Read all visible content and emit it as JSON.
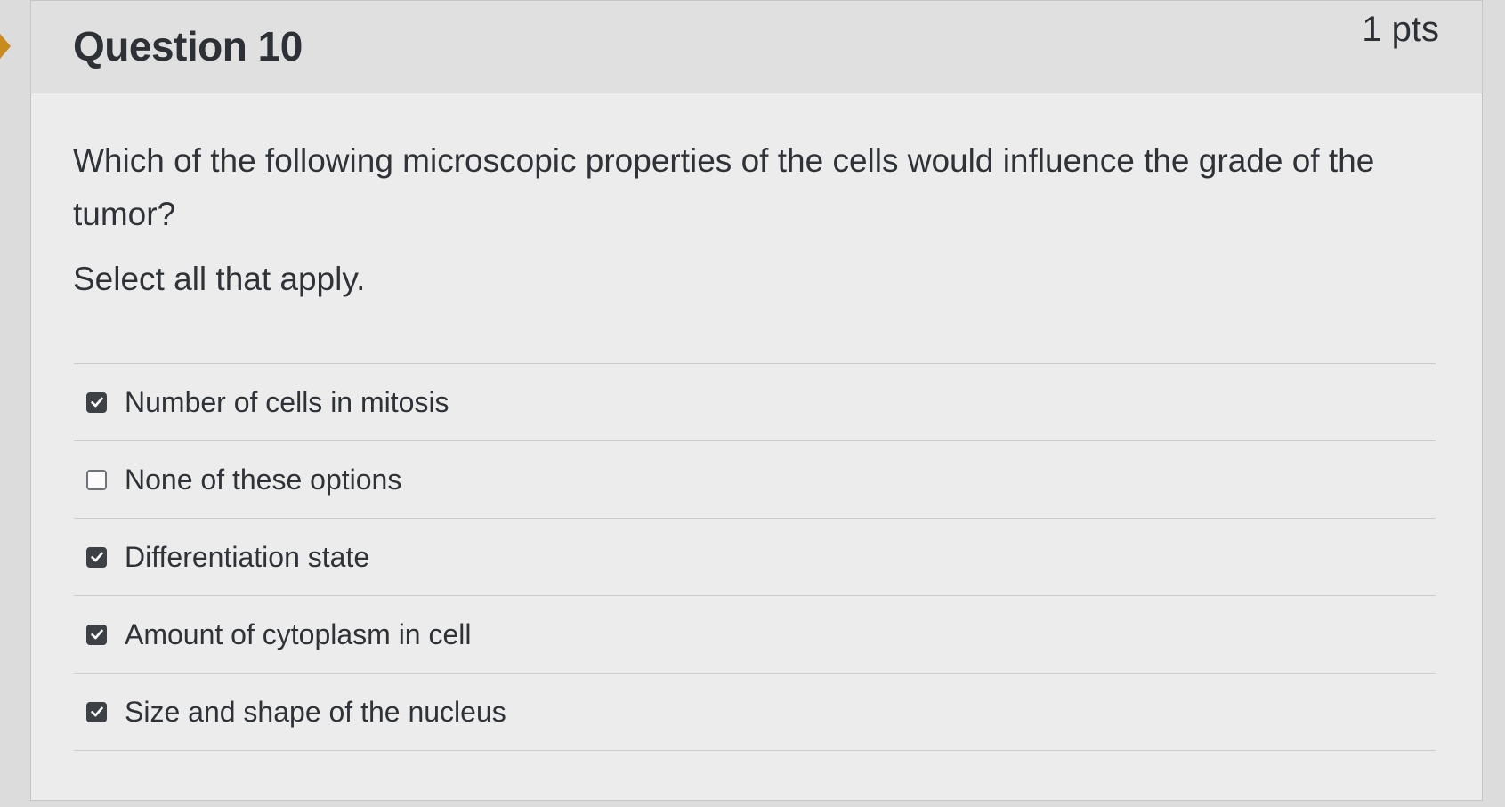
{
  "question": {
    "title": "Question 10",
    "points": "1 pts",
    "text": "Which of the following microscopic properties of the cells would influence the grade of the tumor?",
    "instruction": "Select all that apply."
  },
  "answers": [
    {
      "label": "Number of cells in mitosis",
      "checked": true
    },
    {
      "label": "None of these options",
      "checked": false
    },
    {
      "label": "Differentiation state",
      "checked": true
    },
    {
      "label": "Amount of cytoplasm in cell",
      "checked": true
    },
    {
      "label": "Size and shape of the nucleus",
      "checked": true
    }
  ],
  "colors": {
    "background": "#dcdcdc",
    "card": "#ececec",
    "header": "#e0e0e0",
    "text": "#2f3338",
    "checkbox_checked": "#3d4145",
    "accent_arrow": "#c98a1e"
  },
  "icons": {
    "checkmark": "check-icon",
    "arrow": "question-arrow-icon"
  }
}
